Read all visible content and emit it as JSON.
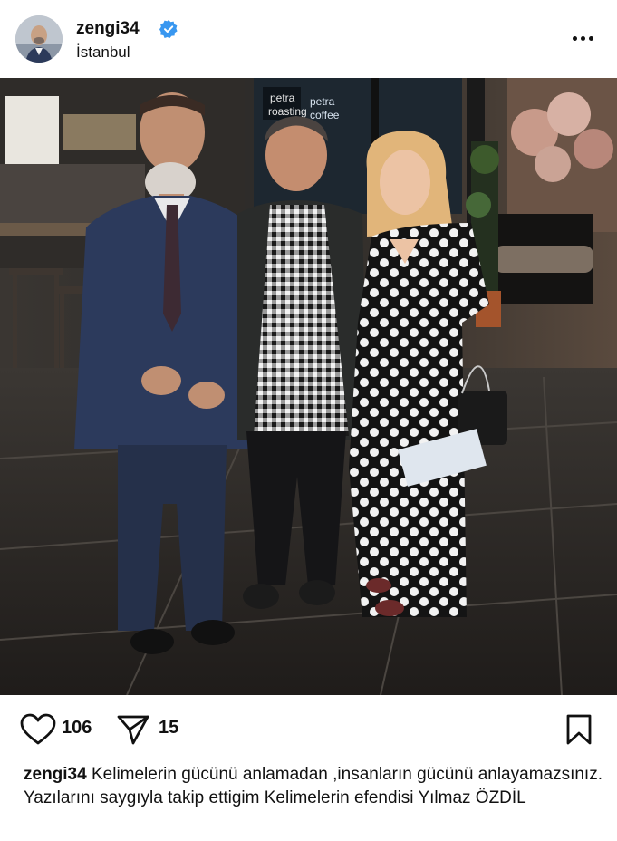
{
  "post": {
    "username": "zengi34",
    "location": "İstanbul",
    "verified": true,
    "likes": "106",
    "shares": "15",
    "caption": "Kelimelerin gücünü anlamadan ,insanların gücünü anlayamazsınız. Yazılarını saygıyla takip ettigim Kelimelerin efendisi Yılmaz ÖZDİL"
  },
  "photo": {
    "signs": [
      "petra",
      "roasting",
      "petra",
      "coffee"
    ]
  },
  "icons": {
    "more": "more-options-icon",
    "like": "heart-icon",
    "share": "send-icon",
    "save": "bookmark-icon",
    "verified": "verified-badge-icon"
  },
  "colors": {
    "verified": "#3897f0",
    "text": "#111111",
    "background": "#ffffff"
  }
}
